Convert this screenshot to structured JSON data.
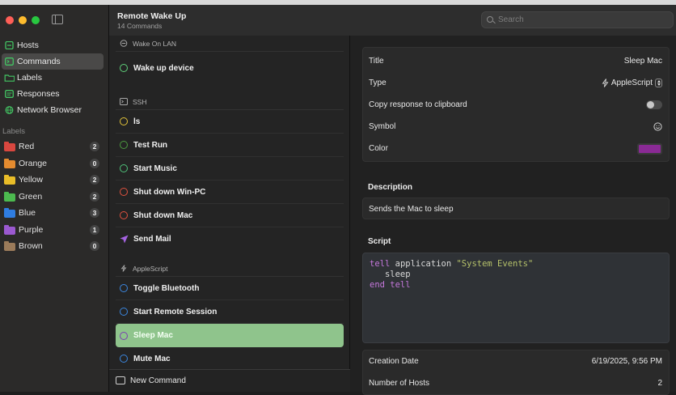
{
  "app": {
    "title": "Remote Wake Up",
    "subtitle": "14 Commands"
  },
  "window_controls": {
    "close_color": "#ff5f57",
    "minimize_color": "#febc2e",
    "zoom_color": "#28c840"
  },
  "sidebar": {
    "items": [
      {
        "label": "Hosts",
        "icon": "server-icon",
        "color": "#43c463"
      },
      {
        "label": "Commands",
        "icon": "terminal-icon",
        "color": "#43c463",
        "selected": true
      },
      {
        "label": "Labels",
        "icon": "folder-icon",
        "color": "#43c463"
      },
      {
        "label": "Responses",
        "icon": "message-icon",
        "color": "#43c463"
      },
      {
        "label": "Network Browser",
        "icon": "globe-icon",
        "color": "#43c463"
      }
    ],
    "labels_title": "Labels",
    "labels": [
      {
        "name": "Red",
        "count": "2",
        "color": "#d9473f"
      },
      {
        "name": "Orange",
        "count": "0",
        "color": "#e48b2f"
      },
      {
        "name": "Yellow",
        "count": "2",
        "color": "#e9bd28"
      },
      {
        "name": "Green",
        "count": "2",
        "color": "#4cba4f"
      },
      {
        "name": "Blue",
        "count": "3",
        "color": "#2f7de1"
      },
      {
        "name": "Purple",
        "count": "1",
        "color": "#9b59d0"
      },
      {
        "name": "Brown",
        "count": "0",
        "color": "#9b7b5a"
      }
    ]
  },
  "search": {
    "placeholder": "Search"
  },
  "commands": {
    "sections": [
      {
        "title": "Wake On LAN",
        "icon": "power-icon",
        "items": [
          {
            "label": "Wake up device",
            "icon": "power-icon",
            "color": "#5fd07a"
          }
        ]
      },
      {
        "title": "SSH",
        "icon": "terminal-icon",
        "items": [
          {
            "label": "ls",
            "icon": "list-icon",
            "color": "#e3c43a"
          },
          {
            "label": "Test Run",
            "icon": "check-icon",
            "color": "#4c9a3f"
          },
          {
            "label": "Start Music",
            "icon": "play-icon",
            "color": "#4fc27a"
          },
          {
            "label": "Shut down Win-PC",
            "icon": "stop-icon",
            "color": "#e0523f"
          },
          {
            "label": "Shut down Mac",
            "icon": "stop-icon",
            "color": "#e0523f"
          },
          {
            "label": "Send Mail",
            "icon": "paperplane-icon",
            "color": "#a463e0"
          }
        ]
      },
      {
        "title": "AppleScript",
        "icon": "applescript-icon",
        "items": [
          {
            "label": "Toggle Bluetooth",
            "icon": "bluetooth-icon",
            "color": "#3b87e0"
          },
          {
            "label": "Start Remote Session",
            "icon": "remote-icon",
            "color": "#3b87e0"
          },
          {
            "label": "Sleep Mac",
            "icon": "moon-icon",
            "color": "#a15ad9",
            "selected": true
          },
          {
            "label": "Mute Mac",
            "icon": "mute-icon",
            "color": "#3b87e0"
          }
        ]
      }
    ],
    "new_command_label": "New Command"
  },
  "detail": {
    "fields": [
      {
        "key": "title",
        "label": "Title",
        "value": "Sleep Mac"
      },
      {
        "key": "type",
        "label": "Type",
        "value": "AppleScript"
      },
      {
        "key": "copy",
        "label": "Copy response to clipboard",
        "value": ""
      },
      {
        "key": "symbol",
        "label": "Symbol",
        "value": ""
      },
      {
        "key": "color",
        "label": "Color",
        "value": ""
      }
    ],
    "color_value": "#8a2a95",
    "copy_response_enabled": false,
    "description_heading": "Description",
    "description": "Sends the Mac to sleep",
    "script_heading": "Script",
    "script": {
      "line1_kw": "tell",
      "line1_text": " application ",
      "line1_str": "\"System Events\"",
      "line2_text": "   sleep",
      "line3_kw": "end tell"
    },
    "meta": [
      {
        "label": "Creation Date",
        "value": "6/19/2025, 9:56 PM"
      },
      {
        "label": "Number of Hosts",
        "value": "2"
      }
    ]
  }
}
